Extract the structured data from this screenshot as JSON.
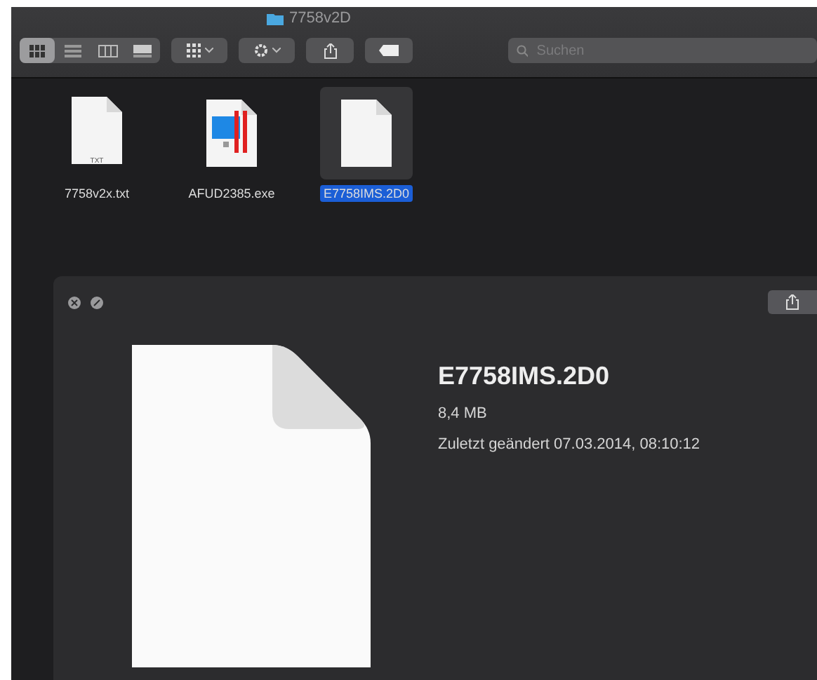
{
  "window": {
    "title": "7758v2D"
  },
  "view_modes": [
    {
      "kind": "icons",
      "selected": true
    },
    {
      "kind": "list",
      "selected": false
    },
    {
      "kind": "columns",
      "selected": false
    },
    {
      "kind": "gallery",
      "selected": false
    }
  ],
  "search": {
    "placeholder": "Suchen"
  },
  "files": [
    {
      "name": "7758v2x.txt",
      "kind": "text",
      "badge": "TXT",
      "selected": false
    },
    {
      "name": "AFUD2385.exe",
      "kind": "app",
      "selected": false
    },
    {
      "name": "E7758IMS.2D0",
      "kind": "blank",
      "selected": true
    }
  ],
  "preview": {
    "name": "E7758IMS.2D0",
    "size": "8,4 MB",
    "modified": "Zuletzt geändert 07.03.2014, 08:10:12"
  }
}
